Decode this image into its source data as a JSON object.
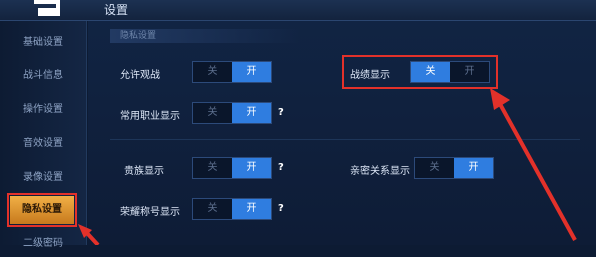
{
  "header": {
    "title": "设置"
  },
  "sidebar": {
    "items": [
      {
        "label": "基础设置"
      },
      {
        "label": "战斗信息"
      },
      {
        "label": "操作设置"
      },
      {
        "label": "音效设置"
      },
      {
        "label": "录像设置"
      },
      {
        "label": "隐私设置",
        "active": true
      },
      {
        "label": "二级密码"
      }
    ]
  },
  "main": {
    "section_title": "隐私设置",
    "settings": [
      {
        "label": "允许观战",
        "off_label": "关",
        "on_label": "开",
        "value": "开"
      },
      {
        "label": "战绩显示",
        "off_label": "关",
        "on_label": "开",
        "value": "关"
      },
      {
        "label": "常用职业显示",
        "off_label": "关",
        "on_label": "开",
        "value": "开",
        "help": "?"
      },
      {
        "label": "贵族显示",
        "off_label": "关",
        "on_label": "开",
        "value": "开",
        "help": "?"
      },
      {
        "label": "亲密关系显示",
        "off_label": "关",
        "on_label": "开",
        "value": "开"
      },
      {
        "label": "荣耀称号显示",
        "off_label": "关",
        "on_label": "开",
        "value": "开",
        "help": "?"
      }
    ]
  },
  "colors": {
    "accent": "#2f7de0",
    "annotation": "#e3312a",
    "active_tab": "#e9a43e"
  }
}
